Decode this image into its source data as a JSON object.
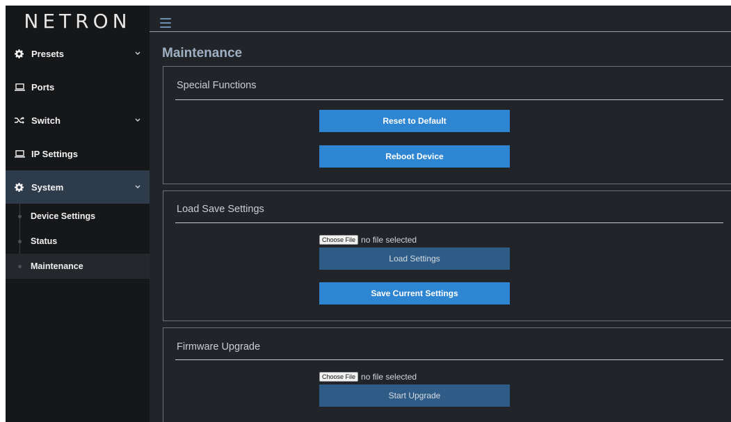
{
  "brand": {
    "logo_text": "NETRON"
  },
  "nav": {
    "items": [
      {
        "label": "Presets",
        "icon": "gear-icon",
        "has_chevron": true
      },
      {
        "label": "Ports",
        "icon": "laptop-icon",
        "has_chevron": false
      },
      {
        "label": "Switch",
        "icon": "shuffle-icon",
        "has_chevron": true
      },
      {
        "label": "IP Settings",
        "icon": "laptop-icon",
        "has_chevron": false
      },
      {
        "label": "System",
        "icon": "gear-icon",
        "has_chevron": true,
        "active": true
      }
    ],
    "sub_items": [
      {
        "label": "Device Settings"
      },
      {
        "label": "Status"
      },
      {
        "label": "Maintenance",
        "active": true
      }
    ]
  },
  "page": {
    "title": "Maintenance"
  },
  "special_functions": {
    "title": "Special Functions",
    "reset_label": "Reset to Default",
    "reboot_label": "Reboot Device"
  },
  "load_save": {
    "title": "Load Save Settings",
    "choose_file_label": "Choose File",
    "file_status": "no file selected",
    "load_label": "Load Settings",
    "save_label": "Save Current Settings"
  },
  "firmware": {
    "title": "Firmware Upgrade",
    "choose_file_label": "Choose File",
    "file_status": "no file selected",
    "upgrade_label": "Start Upgrade"
  },
  "colors": {
    "accent": "#2e86d3",
    "accent_muted": "#2f5c86",
    "sidebar_bg": "#161719",
    "active_bg": "#2e3b4a",
    "content_bg": "#212428"
  }
}
